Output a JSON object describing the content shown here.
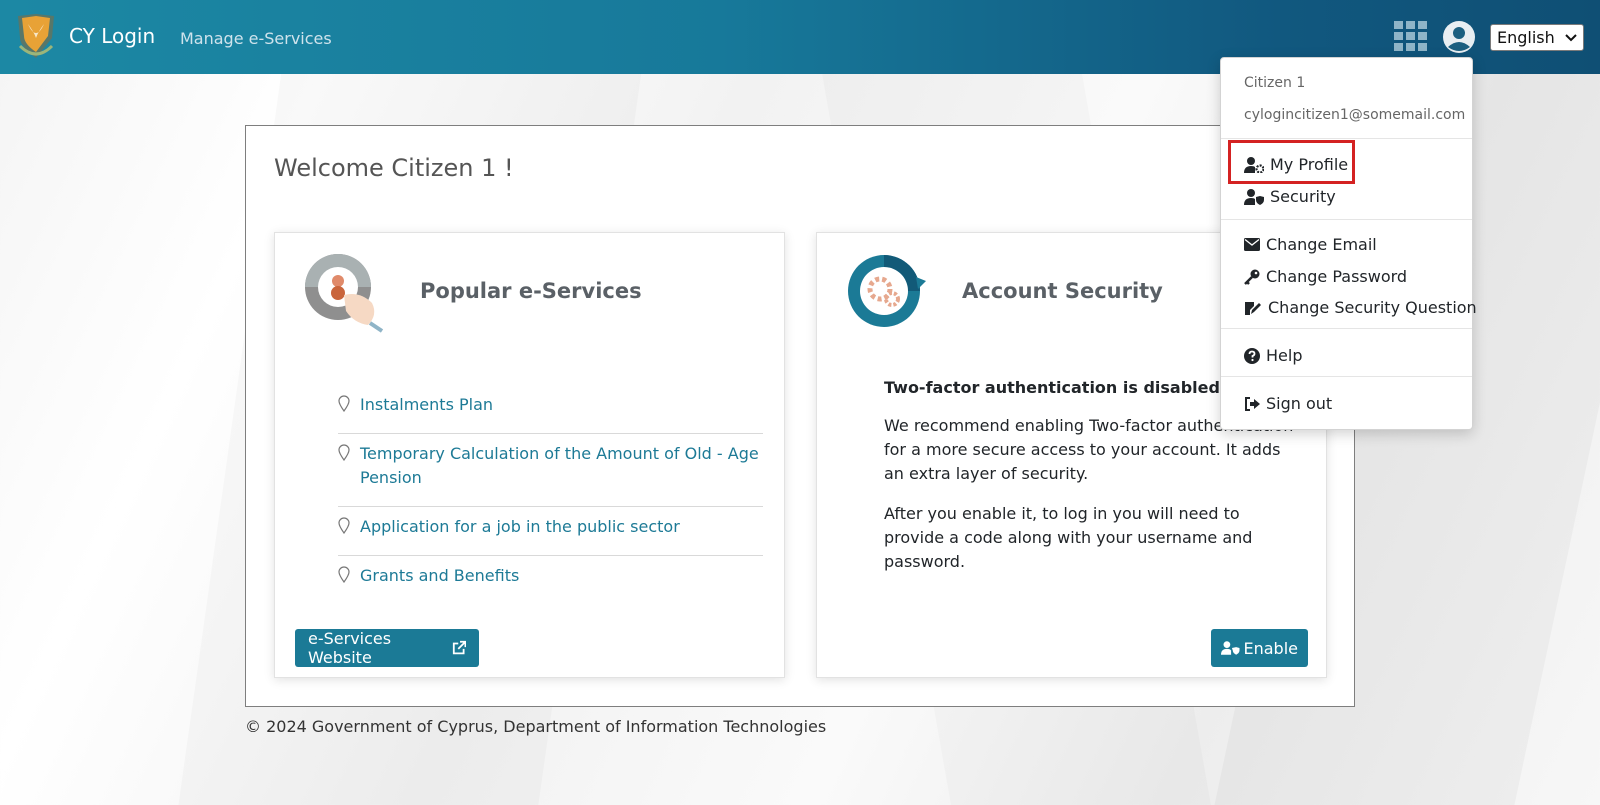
{
  "header": {
    "brand": "CY Login",
    "nav_link": "Manage e-Services",
    "language_selected": "English"
  },
  "main": {
    "welcome": "Welcome Citizen 1 !",
    "popular": {
      "title": "Popular e-Services",
      "items": [
        {
          "label": "Instalments Plan"
        },
        {
          "label": "Temporary Calculation of the Amount of Old - Age Pension"
        },
        {
          "label": "Application for a job in the public sector"
        },
        {
          "label": "Grants and Benefits"
        }
      ],
      "button": "e-Services Website"
    },
    "security": {
      "title": "Account Security",
      "status": "Two-factor authentication is disabled.",
      "paragraph1": "We recommend enabling Two-factor authentication for a more secure access to your account. It adds an extra layer of security.",
      "paragraph2": "After you enable it, to log in you will need to provide a code along with your username and password.",
      "button": "Enable"
    }
  },
  "footer": "© 2024 Government of Cyprus, Department of Information Technologies",
  "user_menu": {
    "name": "Citizen 1",
    "email": "cylogincitizen1@somemail.com",
    "items": {
      "my_profile": "My Profile",
      "security": "Security",
      "change_email": "Change Email",
      "change_password": "Change Password",
      "change_security_question": "Change Security Question",
      "help": "Help",
      "sign_out": "Sign out"
    }
  },
  "colors": {
    "header_start": "#1c88a4",
    "header_end": "#0f4f74",
    "primary": "#1b7a96",
    "highlight": "#d42222"
  }
}
